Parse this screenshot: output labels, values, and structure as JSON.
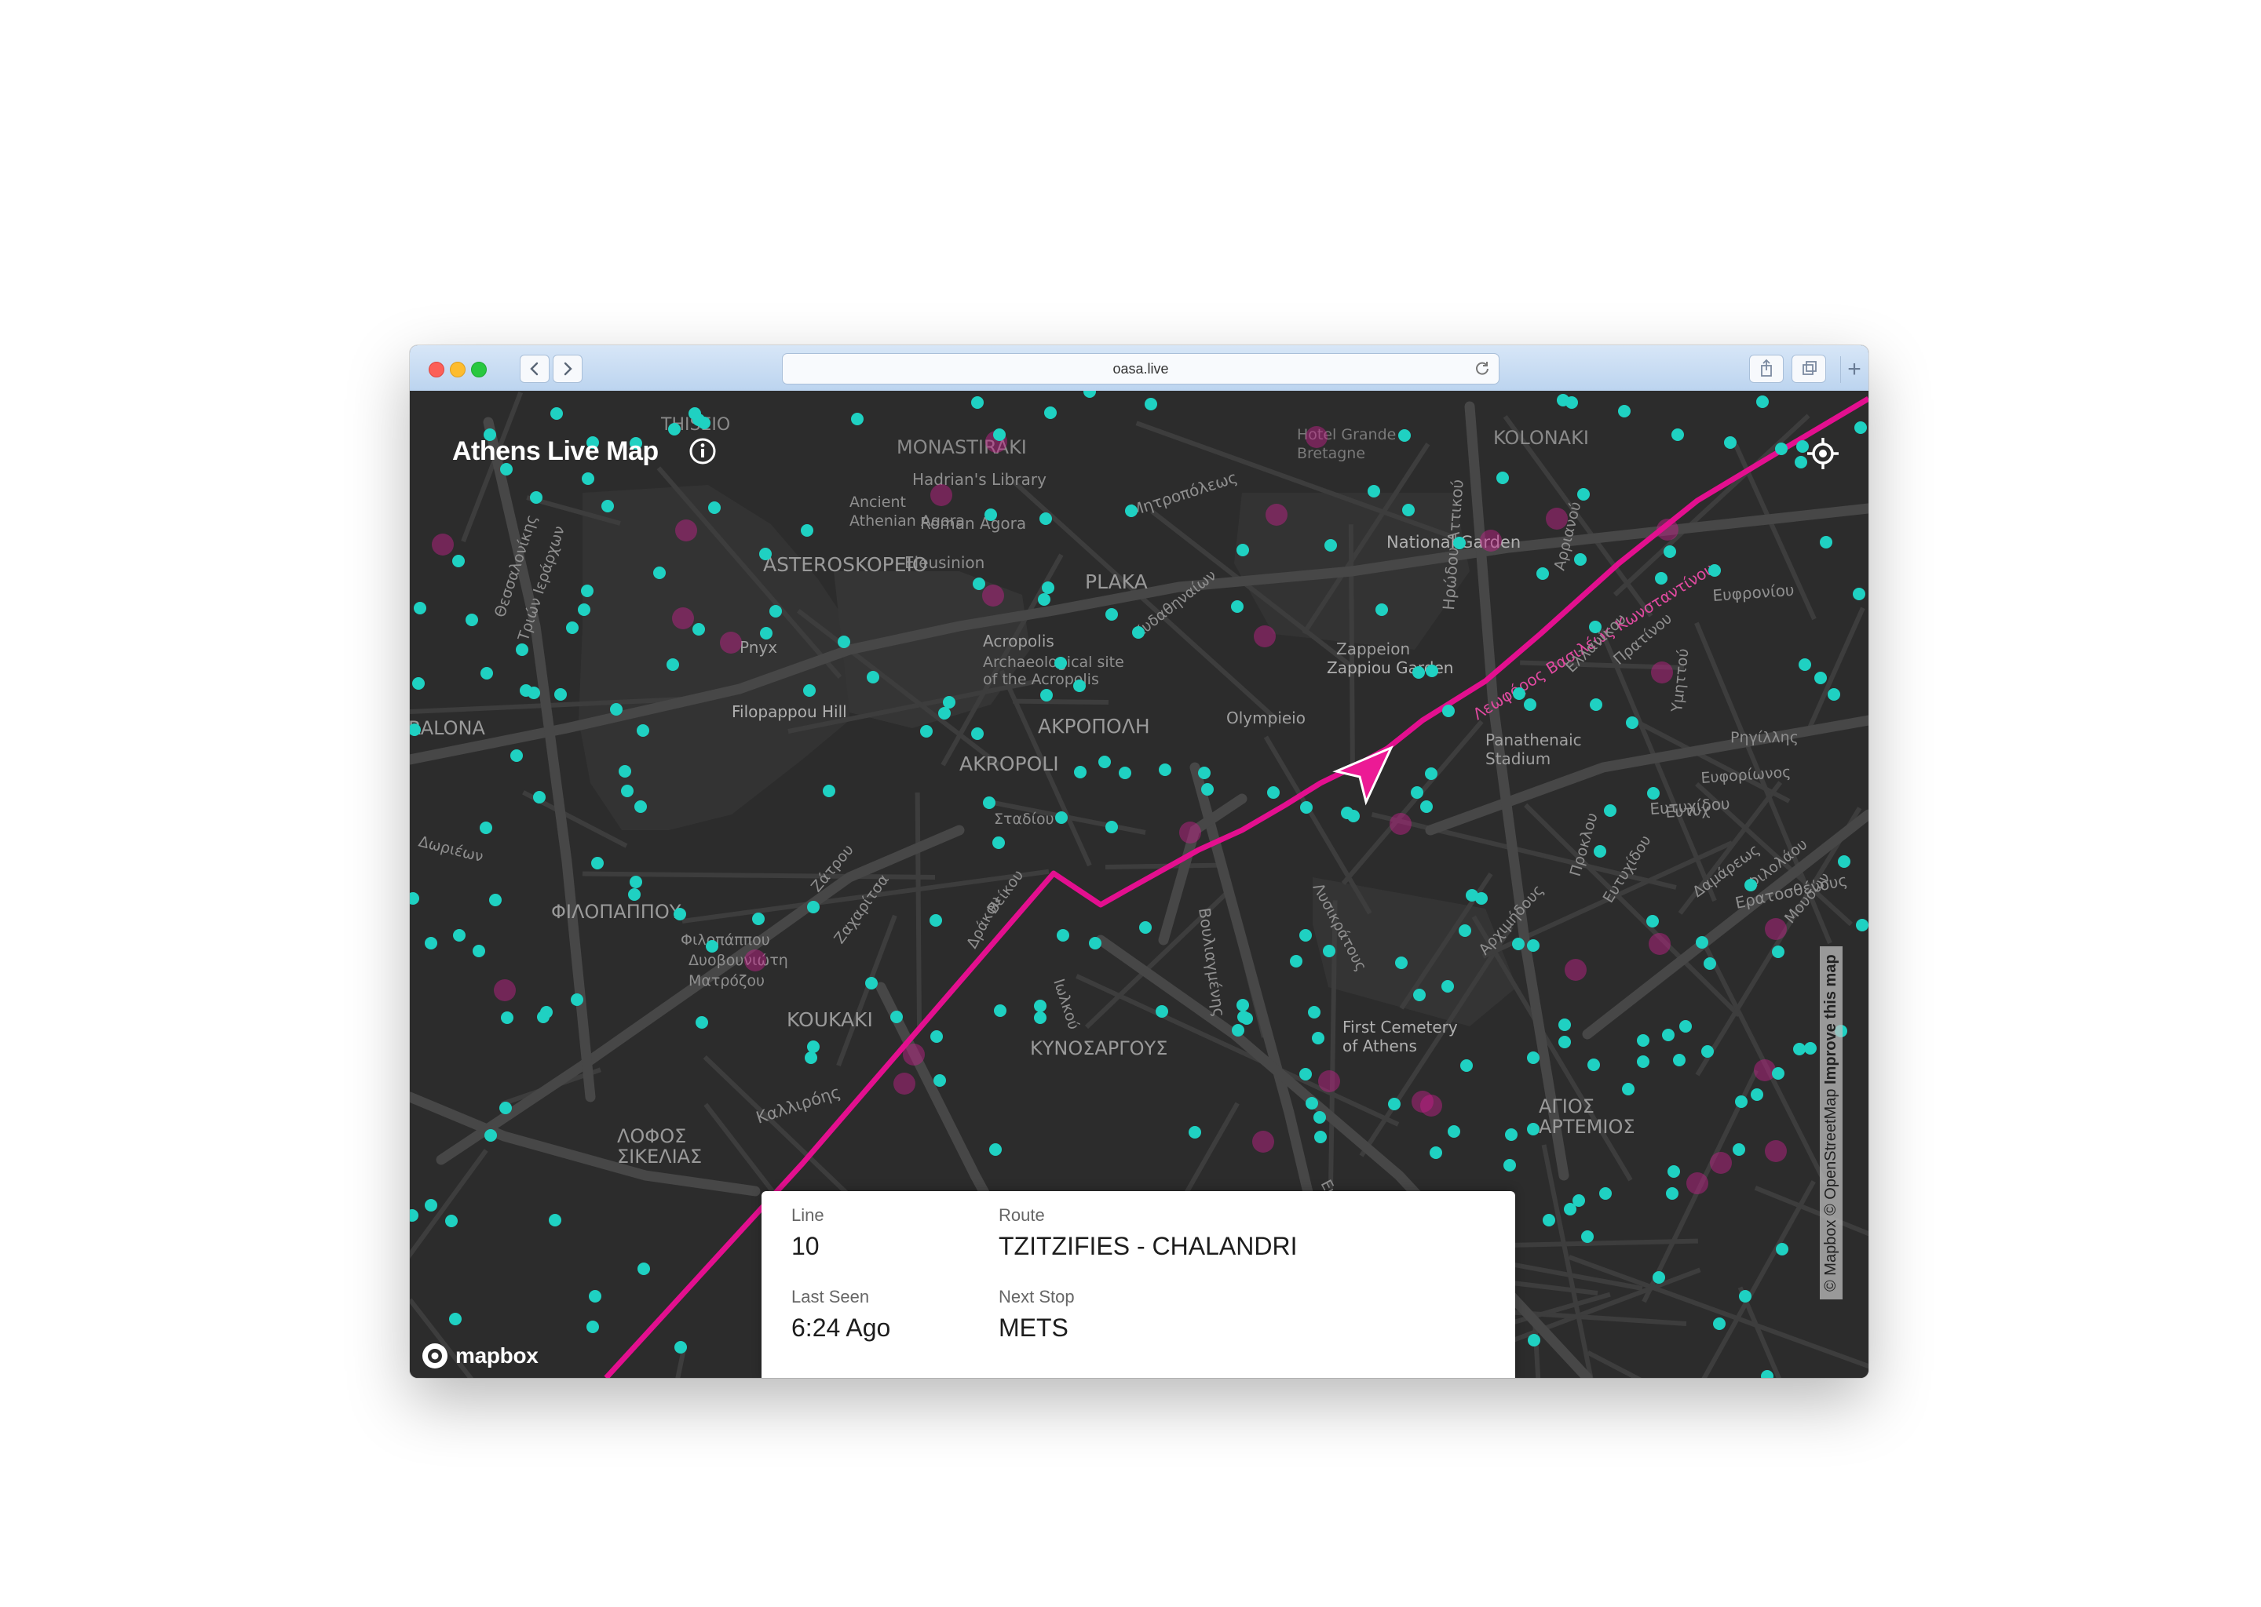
{
  "browser": {
    "url": "oasa.live",
    "back_icon": "chevron-left-icon",
    "forward_icon": "chevron-right-icon",
    "reload_icon": "reload-icon",
    "share_icon": "share-icon",
    "tabs_icon": "tabs-icon",
    "new_tab_icon": "plus-icon"
  },
  "app": {
    "title": "Athens Live Map",
    "info_icon": "info-icon",
    "locate_icon": "locate-icon"
  },
  "map": {
    "labels": [
      "THISEIO",
      "MONASTIRAKI",
      "Hadrian's Library",
      "Ancient",
      "Athenian Agora",
      "Roman Agora",
      "ASTEROSKOPEIO",
      "Eleusinion",
      "PLAKA",
      "National Garden",
      "Hotel Grande",
      "Bretagne",
      "KOLONAKI",
      "Pnyx",
      "Acropolis",
      "Archaeological site",
      "of the Acropolis",
      "Zappeion",
      "Zappiou Garden",
      "Filopappou Hill",
      "Olympieio",
      "ΑΚΡΟΠΟΛΗ",
      "AKROPOLI",
      "Panathenaic",
      "Stadium",
      "ΦΙΛΟΠΑΠΠΟΥ",
      "RALONA",
      "KOUKAKI",
      "ΚΥΝΟΣΑΡΓΟΥΣ",
      "First Cemetery",
      "of Athens",
      "ΑΓΙΟΣ",
      "ΑΡΤΕΜΙΟΣ",
      "ΛΟΦΟΣ",
      "ΣΙΚΕΛΙΑΣ",
      "Φιλοπάππου",
      "Δυοβουνιώτη",
      "Ματρόζου",
      "Καλλιρόης",
      "Μητροπόλεως",
      "Κυδαθηναίων",
      "Ευφρονίου",
      "Ερατοσθένους",
      "Ευτυχίδου",
      "Λεωφόρος Βασιλέως Κωνσταντίνου",
      "Βουλιαγμένης",
      "Ηρώδου Αττικού",
      "Θεσσαλονίκης",
      "Τριών Ιεράρχων",
      "Δωριέων",
      "Ζαχαρίτσα",
      "Δράκου",
      "Βείκου",
      "Ιωλκού",
      "Αρχιμήδους",
      "Προκλου",
      "Ευτυχίδου",
      "Ευτυχ",
      "Ευφορίωνος",
      "Ρηγίλλης",
      "Αρριανού",
      "Ελλανίκου",
      "Πρατίνου",
      "Υμηττού",
      "Δαμάρεως",
      "Φιλολάου",
      "Μουσών",
      "Ζάτρου",
      "Σταδίου",
      "Λυσικράτους",
      "Ευφρονίου"
    ],
    "route_color": "#e30f8f",
    "vehicle_color": "#1fd1c2",
    "stop_color": "#c81e8c",
    "background_color": "#2c2c2c"
  },
  "vehicle_info": {
    "line_label": "Line",
    "line_value": "10",
    "route_label": "Route",
    "route_value": "TZITZIFIES - CHALANDRI",
    "last_seen_label": "Last Seen",
    "last_seen_value": "6:24 Ago",
    "next_stop_label": "Next Stop",
    "next_stop_value": "METS"
  },
  "attribution": {
    "mapbox": "© Mapbox",
    "osm": "© OpenStreetMap",
    "improve": "Improve this map",
    "logo_text": "mapbox",
    "logo_icon": "mapbox-logo-icon"
  }
}
